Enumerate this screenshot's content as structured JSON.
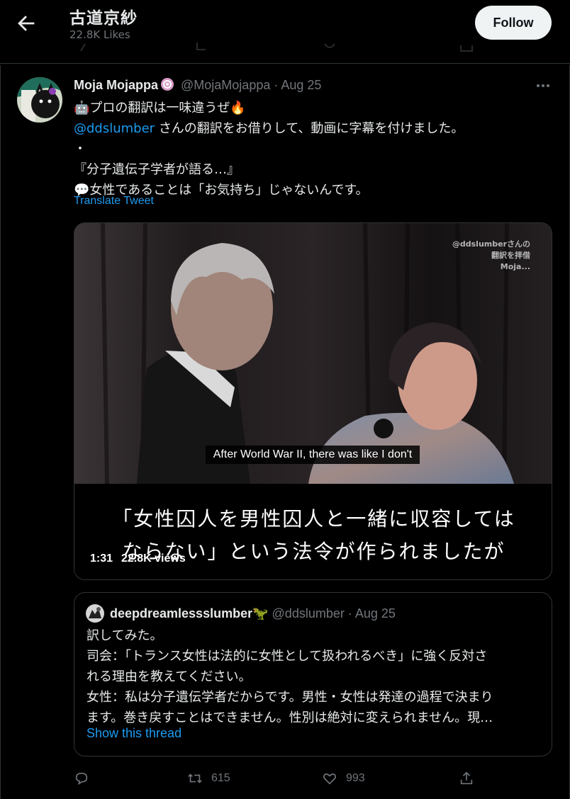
{
  "header": {
    "title": "古道京紗",
    "subtitle": "22.8K Likes",
    "follow_label": "Follow"
  },
  "tweet": {
    "display_name": "Moja Mojappa",
    "handle": "@MojaMojappa",
    "date": "Aug 25",
    "lines": [
      "🤖プロの翻訳は一味違うぜ🔥",
      "さんの翻訳をお借りして、動画に字幕を付けました。",
      "・",
      "『分子遺伝子学者が語る…』",
      "💬女性であることは「お気持ち」じゃないんです。"
    ],
    "mention": "@ddslumber",
    "translate_label": "Translate Tweet"
  },
  "media": {
    "watermark_lines": [
      "@ddslumberさんの",
      "翻訳を拝借",
      "Moja..."
    ],
    "english_subtitle": "After World War II, there was like I don't",
    "japanese_subtitle_lines": [
      "「女性囚人を男性囚人と一緒に収容しては",
      "ならない」という法令が作られましたが"
    ],
    "duration": "1:31",
    "views": "22.8K views"
  },
  "quote": {
    "display_name": "deepdreamlessslumber🦖",
    "handle": "@ddslumber",
    "date": "Aug 25",
    "lines": [
      "訳してみた。",
      "司会：「トランス女性は法的に女性として扱われるべき」に強く反対さ",
      "れる理由を教えてください。",
      "女性：私は分子遺伝学者だからです。男性・女性は発達の過程で決まり",
      "ます。巻き戻すことはできません。性別は絶対に変えられません。現…"
    ],
    "show_thread_label": "Show this thread"
  },
  "actions": {
    "retweets": "615",
    "likes": "993"
  },
  "icons": {
    "back": "back-arrow-icon",
    "more": "more-icon",
    "reply": "reply-icon",
    "retweet": "retweet-icon",
    "like": "heart-icon",
    "share": "share-icon"
  },
  "colors": {
    "background": "#000000",
    "accent": "#1d9bf0",
    "secondary_text": "#71767b",
    "border": "#2f3336"
  }
}
